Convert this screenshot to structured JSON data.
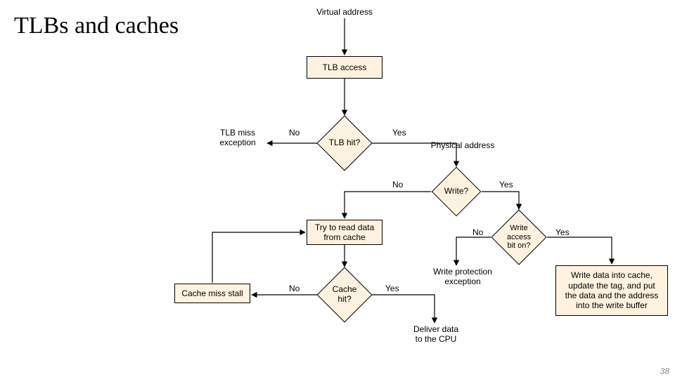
{
  "title": "TLBs and caches",
  "page_number": "38",
  "nodes": {
    "virtual_address": "Virtual address",
    "tlb_access": "TLB access",
    "tlb_miss_exception": "TLB miss\nexception",
    "tlb_hit": "TLB hit?",
    "physical_address": "Physical  address",
    "write_q": "Write?",
    "try_read_cache": "Try to read data\nfrom cache",
    "write_access_bit": "Write access\nbit on?",
    "write_protection_exception": "Write protection\nexception",
    "cache_miss_stall": "Cache miss stall",
    "cache_hit": "Cache hit?",
    "write_data": "Write data into cache,\nupdate the tag, and put\nthe data and the address\ninto the write buffer",
    "deliver_data": "Deliver data\nto the CPU"
  },
  "edges": {
    "tlb_hit_no": "No",
    "tlb_hit_yes": "Yes",
    "write_no": "No",
    "write_yes": "Yes",
    "write_access_no": "No",
    "write_access_yes": "Yes",
    "cache_hit_no": "No",
    "cache_hit_yes": "Yes"
  }
}
